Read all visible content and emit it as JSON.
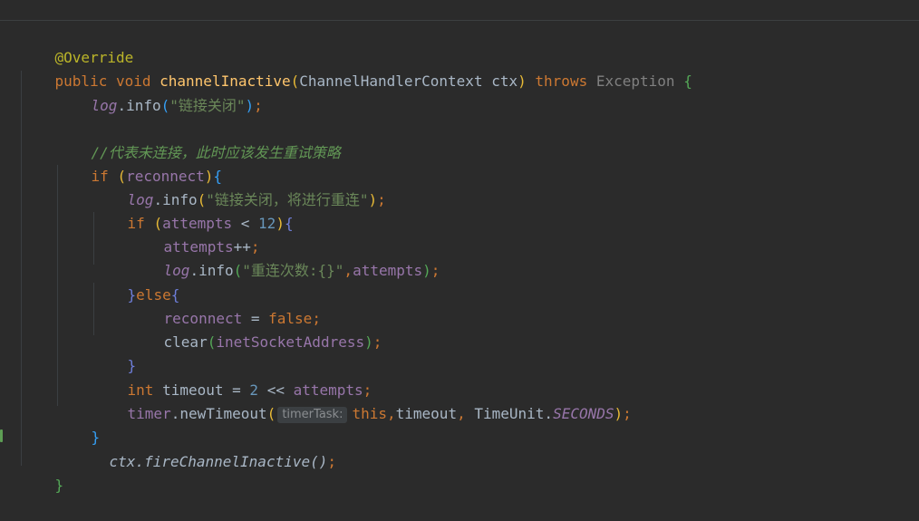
{
  "code": {
    "annotation": "@Override",
    "sig_public": "public",
    "sig_void": "void",
    "method_name": "channelInactive",
    "param_type": "ChannelHandlerContext",
    "param_name": "ctx",
    "kw_throws": "throws",
    "exception": "Exception",
    "log": "log",
    "info": "info",
    "str_closed": "\"链接关闭\"",
    "comment": "//代表未连接，此时应该发生重试策略",
    "kw_if": "if",
    "reconnect": "reconnect",
    "str_closed_retry": "\"链接关闭，将进行重连\"",
    "attempts": "attempts",
    "num_12": "12",
    "op_lt": " < ",
    "op_inc": "++",
    "str_retry_count": "\"重连次数:{}\"",
    "kw_else": "else",
    "op_assign": " = ",
    "kw_false": "false",
    "clear": "clear",
    "inet_address": "inetSocketAddress",
    "kw_int": "int",
    "timeout": "timeout",
    "num_2": "2",
    "op_shift": " << ",
    "timer": "timer",
    "new_timeout": "newTimeout",
    "hint_timer_task": "timerTask:",
    "kw_this": "this",
    "time_unit": "TimeUnit",
    "seconds": "SECONDS",
    "ctx": "ctx",
    "fire_inactive": "fireChannelInactive"
  },
  "colors": {
    "background": "#2b2b2b",
    "keyword": "#cc7832",
    "string": "#6a8759",
    "number": "#6897bb",
    "field": "#9876aa",
    "method_decl": "#ffc66d",
    "comment": "#629755",
    "annotation": "#bbb529"
  }
}
